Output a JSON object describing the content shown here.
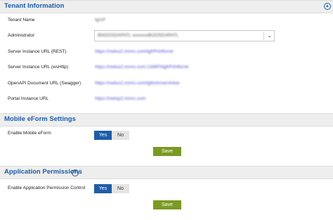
{
  "tenant_section": {
    "title": "Tenant Information",
    "tenant_name": {
      "label": "Tenant Name",
      "value": "tgmP"
    },
    "administrator": {
      "label": "Administrator",
      "value": "BNOOSDAPATL xxxxxxxBOOSDAPATL"
    },
    "server_rest": {
      "label": "Server Instance URL (REST)",
      "value": "https://nwtso2.nnnrs.com/tgfrPrtnflsrrer"
    },
    "server_wshttp": {
      "label": "Server Instance URL (wsHttp)",
      "value": "https://nwtso2.nnnrs.com:1346FhtgfrPrtnflsrrer"
    },
    "openapi": {
      "label": "OpenAPI Document URL (Swagger)",
      "value": "https://nwtso2.nnnrs.com/tgfsrtnrservlntoe"
    },
    "portal": {
      "label": "Portal Instance URL",
      "value": "https://nwtsp2.nnnrs.com"
    }
  },
  "eform_section": {
    "title": "Mobile eForm Settings",
    "enable_label": "Enable Mobile eForm",
    "yes": "Yes",
    "no": "No",
    "save": "Save"
  },
  "permissions_section": {
    "title": "Application Permissions",
    "enable_label": "Enable Application Permission Control",
    "yes": "Yes",
    "no": "No",
    "save": "Save"
  },
  "icons": {
    "help": "?",
    "scroll_up": "^",
    "dropdown": "chevron-down"
  },
  "colors": {
    "accent": "#1c5da8",
    "save_button": "#7a9a21",
    "link": "#4a4fd0"
  }
}
